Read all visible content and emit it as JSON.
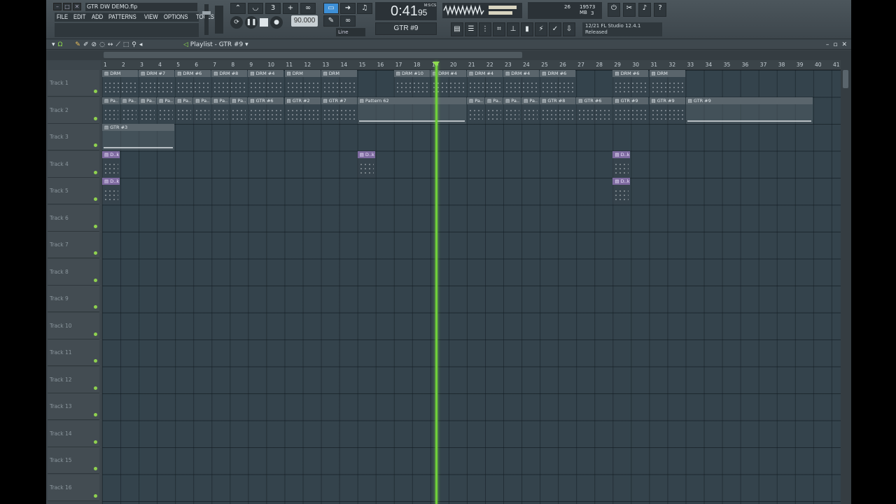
{
  "window": {
    "song_title": "GTR DW DEMO.flp",
    "menu": [
      "FILE",
      "EDIT",
      "ADD",
      "PATTERNS",
      "VIEW",
      "OPTIONS",
      "TOOLS",
      "?"
    ]
  },
  "transport": {
    "time_main": "0:41",
    "time_sub": "95",
    "time_unit": "M:S:CS",
    "tempo": "90.000",
    "pattern": "GTR #9",
    "snap": "Line"
  },
  "monitor": {
    "cpu_value": "26",
    "memory": "19573 MB",
    "polyphony": "3"
  },
  "news": {
    "line1": "12/21  FL Studio 12.4.1",
    "line2": "Released"
  },
  "playlist": {
    "title": "Playlist - GTR #9",
    "tracks": [
      "Track 1",
      "Track 2",
      "Track 3",
      "Track 4",
      "Track 5",
      "Track 6",
      "Track 7",
      "Track 8",
      "Track 9",
      "Track 10",
      "Track 11",
      "Track 12",
      "Track 13",
      "Track 14",
      "Track 15",
      "Track 16"
    ],
    "bars": [
      "1",
      "2",
      "3",
      "4",
      "5",
      "6",
      "7",
      "8",
      "9",
      "10",
      "11",
      "12",
      "13",
      "14",
      "15",
      "16",
      "17",
      "18",
      "19",
      "20",
      "21",
      "22",
      "23",
      "24",
      "25",
      "26",
      "27",
      "28",
      "29",
      "30",
      "31",
      "32",
      "33",
      "34",
      "35",
      "36",
      "37",
      "38",
      "39",
      "40",
      "41"
    ],
    "clips": [
      {
        "track": 1,
        "start": 1,
        "len": 2,
        "label": "DRM",
        "kind": "pattern"
      },
      {
        "track": 1,
        "start": 3,
        "len": 2,
        "label": "DRM #7",
        "kind": "pattern"
      },
      {
        "track": 1,
        "start": 5,
        "len": 2,
        "label": "DRM #6",
        "kind": "pattern"
      },
      {
        "track": 1,
        "start": 7,
        "len": 2,
        "label": "DRM #8",
        "kind": "pattern"
      },
      {
        "track": 1,
        "start": 9,
        "len": 2,
        "label": "DRM #4",
        "kind": "pattern"
      },
      {
        "track": 1,
        "start": 11,
        "len": 2,
        "label": "DRM",
        "kind": "pattern"
      },
      {
        "track": 1,
        "start": 13,
        "len": 2,
        "label": "DRM",
        "kind": "pattern"
      },
      {
        "track": 1,
        "start": 17,
        "len": 2,
        "label": "DRM #10",
        "kind": "pattern"
      },
      {
        "track": 1,
        "start": 19,
        "len": 2,
        "label": "DRM #4",
        "kind": "pattern"
      },
      {
        "track": 1,
        "start": 21,
        "len": 2,
        "label": "DRM #4",
        "kind": "pattern"
      },
      {
        "track": 1,
        "start": 23,
        "len": 2,
        "label": "DRM #4",
        "kind": "pattern"
      },
      {
        "track": 1,
        "start": 25,
        "len": 2,
        "label": "DRM #6",
        "kind": "pattern"
      },
      {
        "track": 1,
        "start": 29,
        "len": 2,
        "label": "DRM #6",
        "kind": "pattern"
      },
      {
        "track": 1,
        "start": 31,
        "len": 2,
        "label": "DRM",
        "kind": "pattern"
      },
      {
        "track": 2,
        "start": 1,
        "len": 1,
        "label": "Pa..",
        "kind": "pattern"
      },
      {
        "track": 2,
        "start": 2,
        "len": 1,
        "label": "Pa..",
        "kind": "pattern"
      },
      {
        "track": 2,
        "start": 3,
        "len": 1,
        "label": "Pa..",
        "kind": "pattern"
      },
      {
        "track": 2,
        "start": 4,
        "len": 1,
        "label": "Pa..",
        "kind": "pattern"
      },
      {
        "track": 2,
        "start": 5,
        "len": 1,
        "label": "Pa..",
        "kind": "pattern"
      },
      {
        "track": 2,
        "start": 6,
        "len": 1,
        "label": "Pa..",
        "kind": "pattern"
      },
      {
        "track": 2,
        "start": 7,
        "len": 1,
        "label": "Pa..",
        "kind": "pattern"
      },
      {
        "track": 2,
        "start": 8,
        "len": 1,
        "label": "Pa..",
        "kind": "pattern"
      },
      {
        "track": 2,
        "start": 9,
        "len": 2,
        "label": "GTR #6",
        "kind": "pattern"
      },
      {
        "track": 2,
        "start": 11,
        "len": 2,
        "label": "GTR #2",
        "kind": "pattern"
      },
      {
        "track": 2,
        "start": 13,
        "len": 2,
        "label": "GTR #7",
        "kind": "pattern"
      },
      {
        "track": 2,
        "start": 15,
        "len": 6,
        "label": "Pattern 62",
        "kind": "line"
      },
      {
        "track": 2,
        "start": 21,
        "len": 1,
        "label": "Pa..",
        "kind": "pattern"
      },
      {
        "track": 2,
        "start": 22,
        "len": 1,
        "label": "Pa..",
        "kind": "pattern"
      },
      {
        "track": 2,
        "start": 23,
        "len": 1,
        "label": "Pa..",
        "kind": "pattern"
      },
      {
        "track": 2,
        "start": 24,
        "len": 1,
        "label": "Pa..",
        "kind": "pattern"
      },
      {
        "track": 2,
        "start": 25,
        "len": 2,
        "label": "GTR #8",
        "kind": "pattern"
      },
      {
        "track": 2,
        "start": 27,
        "len": 2,
        "label": "GTR #6",
        "kind": "pattern"
      },
      {
        "track": 2,
        "start": 29,
        "len": 2,
        "label": "GTR #9",
        "kind": "pattern"
      },
      {
        "track": 2,
        "start": 31,
        "len": 2,
        "label": "GTR #9",
        "kind": "pattern"
      },
      {
        "track": 2,
        "start": 33,
        "len": 7,
        "label": "GTR #9",
        "kind": "line"
      },
      {
        "track": 3,
        "start": 1,
        "len": 4,
        "label": "GTR #3",
        "kind": "line"
      },
      {
        "track": 4,
        "start": 1,
        "len": 1,
        "label": "D..k",
        "kind": "audio"
      },
      {
        "track": 4,
        "start": 15,
        "len": 1,
        "label": "D..k",
        "kind": "audio"
      },
      {
        "track": 4,
        "start": 29,
        "len": 1,
        "label": "D..k",
        "kind": "audio"
      },
      {
        "track": 5,
        "start": 1,
        "len": 1,
        "label": "D..k",
        "kind": "audio"
      },
      {
        "track": 5,
        "start": 29,
        "len": 1,
        "label": "D..k",
        "kind": "audio"
      }
    ]
  }
}
